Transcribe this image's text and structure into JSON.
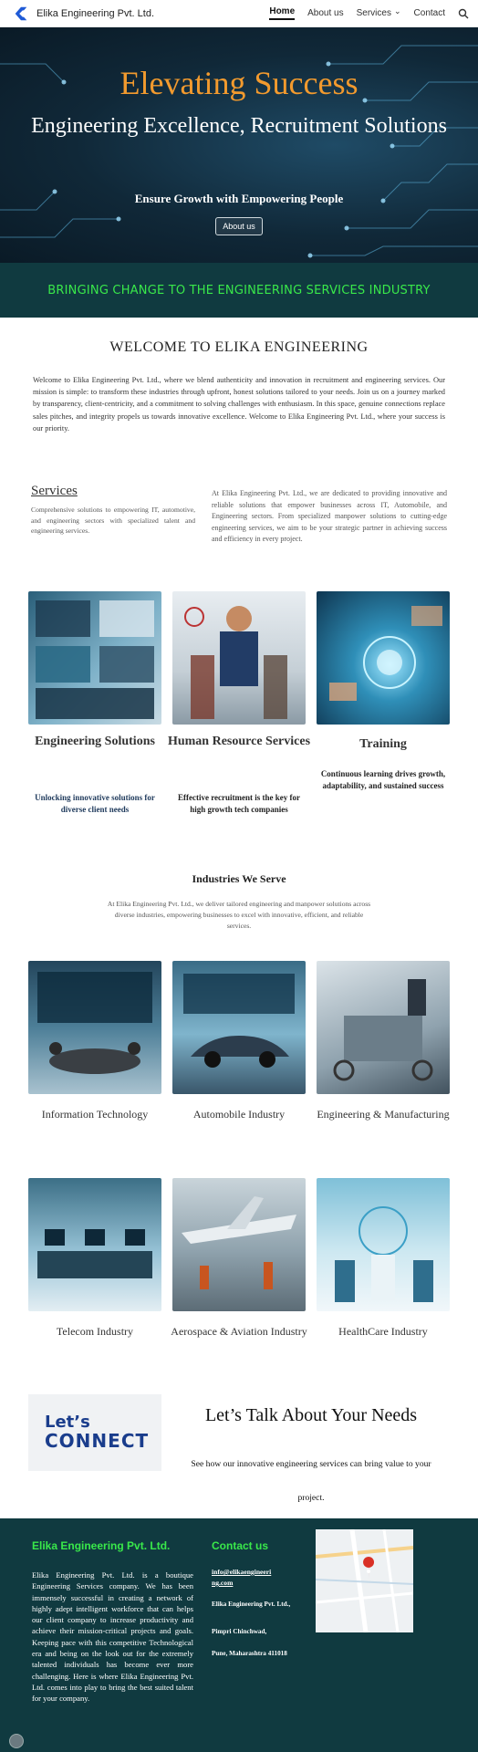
{
  "header": {
    "brand": "Elika Engineering Pvt. Ltd.",
    "nav": [
      "Home",
      "About us",
      "Services",
      "Contact"
    ],
    "logo_icon": "elika-e-logo-icon",
    "search_icon": "search-icon"
  },
  "hero": {
    "title": "Elevating Success",
    "subtitle": "Engineering Excellence, Recruitment Solutions",
    "tagline": "Ensure Growth with Empowering People",
    "button": "About us",
    "colors": {
      "title": "#f29a2e",
      "background": "#102838"
    }
  },
  "banner": {
    "text": "BRINGING CHANGE TO THE ENGINEERING SERVICES INDUSTRY",
    "colors": {
      "text": "#39e84a",
      "background": "#103a40"
    }
  },
  "welcome": {
    "title": "WELCOME TO ELIKA ENGINEERING",
    "text": "Welcome to Elika Engineering Pvt. Ltd., where we blend authenticity and innovation in recruitment and engineering services. Our mission is simple: to transform these industries through upfront, honest solutions tailored to your needs. Join us on a journey marked by transparency, client-centricity, and a commitment to solving challenges with enthusiasm. In this space, genuine connections replace sales pitches, and integrity propels us towards innovative excellence. Welcome to Elika Engineering Pvt. Ltd., where your success is our priority."
  },
  "services": {
    "title": "Services",
    "intro_left": "Comprehensive solutions to empowering IT, automotive, and engineering sectors with specialized talent and engineering services.",
    "intro_right": "At Elika Engineering Pvt. Ltd., we are dedicated to providing innovative and reliable solutions that empower businesses across IT, Automobile, and Engineering sectors. From specialized manpower solutions to cutting-edge engineering services, we aim to be your strategic partner in achieving success and efficiency in every project.",
    "cards": [
      {
        "title": "Engineering Solutions",
        "desc": "Unlocking innovative solutions for diverse client needs"
      },
      {
        "title": "Human Resource Services",
        "desc": "Effective recruitment is the key for high growth tech companies"
      },
      {
        "title": "Training",
        "desc": "Continuous learning drives growth, adaptability, and sustained success"
      }
    ]
  },
  "industries": {
    "title": "Industries We Serve",
    "text": "At Elika Engineering Pvt. Ltd., we deliver tailored engineering and manpower solutions across diverse industries, empowering businesses to excel with innovative, efficient, and reliable services.",
    "items": [
      "Information Technology",
      "Automobile Industry",
      "Engineering & Manufacturing",
      "Telecom Industry",
      "Aerospace & Aviation Industry",
      "HealthCare Industry"
    ]
  },
  "connect": {
    "image_line1": "Let’s",
    "image_line2": "CONNECT",
    "title": "Let’s Talk About Your Needs",
    "text": "See how our innovative engineering services can bring value to your project."
  },
  "footer": {
    "company_title": "Elika Engineering Pvt. Ltd.",
    "about": "Elika Engineering Pvt. Ltd. is a boutique Engineering Services company. We has been immensely successful in creating a network of highly adept intelligent workforce that can helps our client company to increase productivity and achieve their mission-critical projects and goals. Keeping pace with this competitive Technological era and being on the look out for the extremely talented individuals has become ever more challenging. Here is where Elika Engineering Pvt. Ltd. comes into play to bring the best suited talent for your company.",
    "contact_title": "Contact us",
    "email": "info@elikaengineering.com",
    "address_line1": "Elika Engineering Pvt. Ltd.,",
    "address_line2": "Pimpri Chinchwad,",
    "address_line3": "Pune, Maharashtra 411018",
    "colors": {
      "title": "#39e84a",
      "background": "#103a40"
    }
  }
}
